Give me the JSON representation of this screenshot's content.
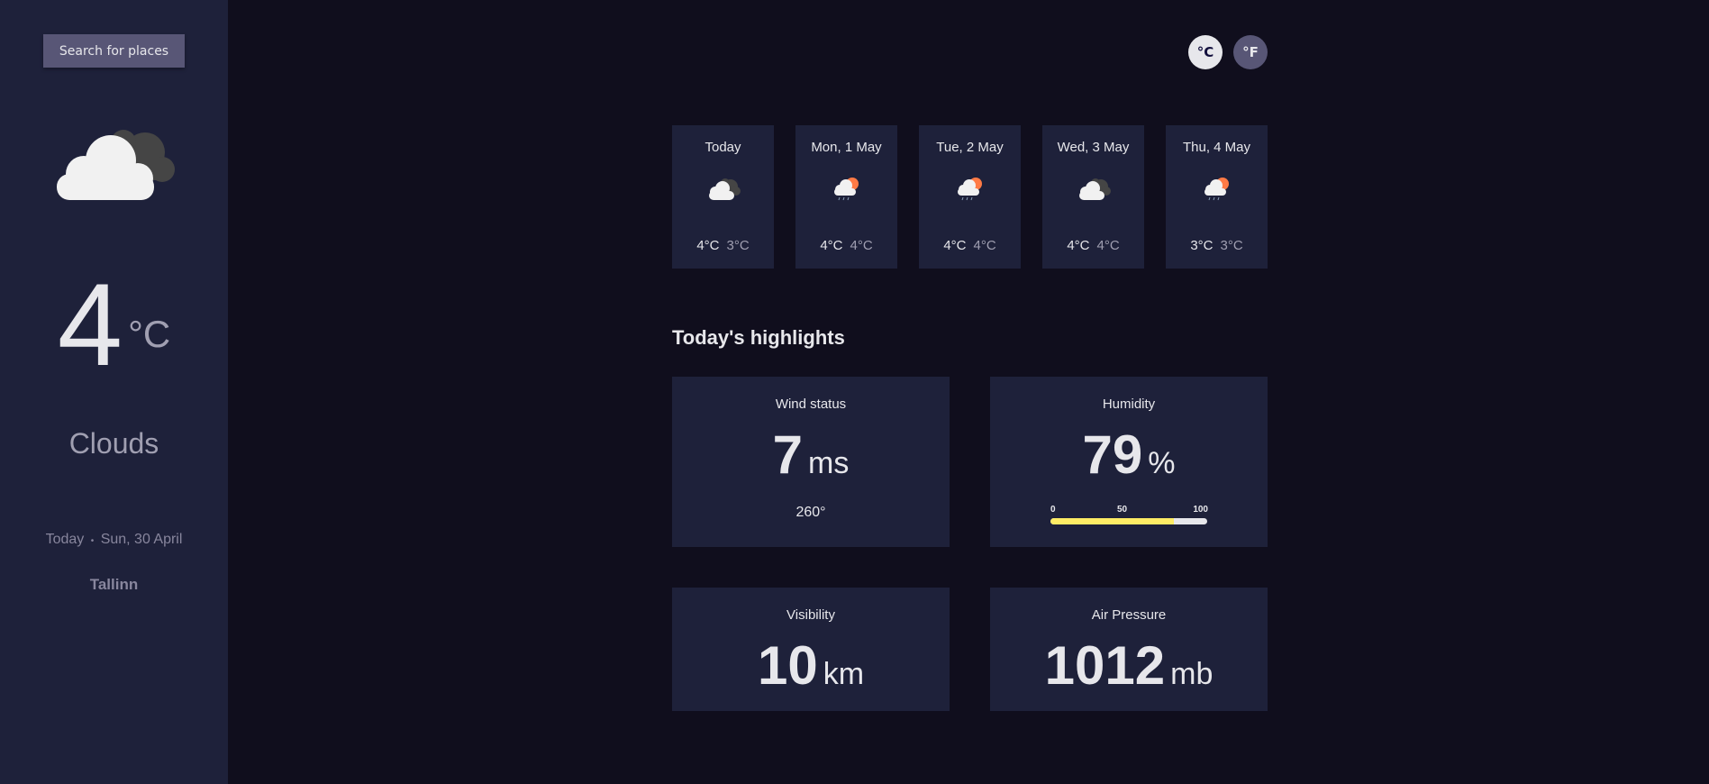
{
  "sidebar": {
    "search_label": "Search for places",
    "current_icon": "clouds-icon",
    "temp_value": "4",
    "temp_unit": "°C",
    "description": "Clouds",
    "date_prefix": "Today",
    "date_sep": "•",
    "date": "Sun, 30 April",
    "location": "Tallinn"
  },
  "units": {
    "celsius": "°C",
    "fahrenheit": "°F"
  },
  "forecast": [
    {
      "date": "Today",
      "icon": "clouds-icon",
      "max": "4°C",
      "min": "3°C"
    },
    {
      "date": "Mon, 1 May",
      "icon": "sun-rain-cloud-icon",
      "max": "4°C",
      "min": "4°C"
    },
    {
      "date": "Tue, 2 May",
      "icon": "sun-rain-cloud-icon",
      "max": "4°C",
      "min": "4°C"
    },
    {
      "date": "Wed, 3 May",
      "icon": "clouds-icon",
      "max": "4°C",
      "min": "4°C"
    },
    {
      "date": "Thu, 4 May",
      "icon": "sun-rain-cloud-icon",
      "max": "3°C",
      "min": "3°C"
    }
  ],
  "highlights": {
    "title": "Today's highlights",
    "wind": {
      "label": "Wind status",
      "value": "7",
      "unit": "ms",
      "direction": "260°"
    },
    "humidity": {
      "label": "Humidity",
      "value": "79",
      "unit": "%",
      "percent": 79,
      "scale": [
        "0",
        "50",
        "100"
      ]
    },
    "visibility": {
      "label": "Visibility",
      "value": "10",
      "unit": "km"
    },
    "pressure": {
      "label": "Air Pressure",
      "value": "1012",
      "unit": "mb"
    }
  },
  "colors": {
    "background": "#100e1d",
    "panel": "#1e213a",
    "accent_button": "#585676",
    "humidity_bar": "#ffec65",
    "sun": "#ff7a45"
  }
}
